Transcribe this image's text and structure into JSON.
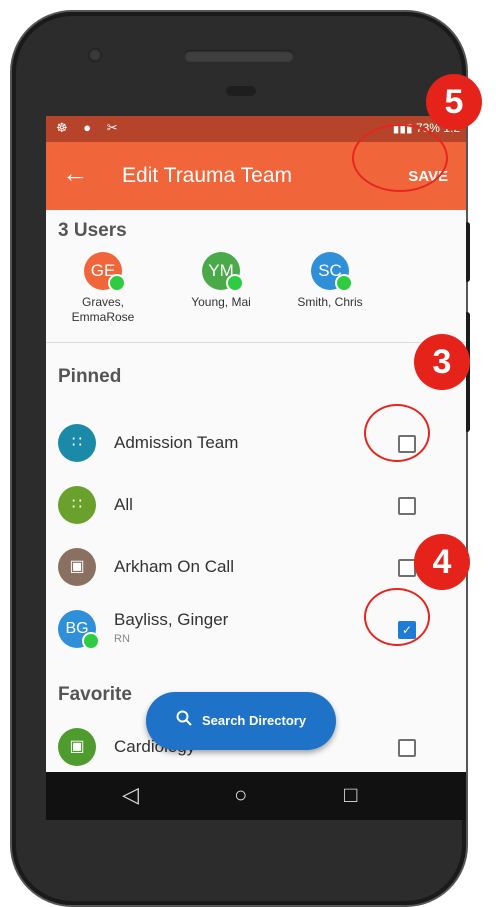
{
  "app": {
    "title": "Edit Trauma Team",
    "back_icon": "←",
    "save_label": "SAVE",
    "accent_color": "#f0663a",
    "status_bar_color": "#b5442a"
  },
  "status_bar": {
    "left_icons": "☸ ● ✂",
    "battery": "73%",
    "time": "1:2"
  },
  "users": {
    "count_label": "3 Users",
    "items": [
      {
        "initials": "GE",
        "name": "Graves, EmmaRose",
        "color": "#f0663a"
      },
      {
        "initials": "YM",
        "name": "Young, Mai",
        "color": "#4aaa4a"
      },
      {
        "initials": "SC",
        "name": "Smith, Chris",
        "color": "#2f8fd8"
      }
    ]
  },
  "pinned": {
    "title": "Pinned",
    "items": [
      {
        "label": "Admission Team",
        "icon": "wifi-icon",
        "glyph": "∷",
        "color": "#1b8aa8",
        "checked": false
      },
      {
        "label": "All",
        "icon": "wifi-icon",
        "glyph": "∷",
        "color": "#6aa12d",
        "checked": false
      },
      {
        "label": "Arkham On Call",
        "icon": "calendar-icon",
        "glyph": "▣",
        "color": "#8a7060",
        "checked": false
      },
      {
        "label": "Bayliss, Ginger",
        "sub": "RN",
        "initials": "BG",
        "color": "#2f8fd8",
        "checked": true
      }
    ]
  },
  "favorite": {
    "title": "Favorite",
    "items": [
      {
        "label": "Cardiology",
        "icon": "calendar-icon",
        "glyph": "▣",
        "color": "#4e9b2e",
        "checked": false
      }
    ]
  },
  "search_button": {
    "label": "Search Directory",
    "icon": "search-icon",
    "glyph": "🔍"
  },
  "nav": {
    "back": "◁",
    "home": "○",
    "recents": "□"
  },
  "annotations": {
    "save_step": "5",
    "checkbox_step": "3",
    "checked_step": "4"
  }
}
